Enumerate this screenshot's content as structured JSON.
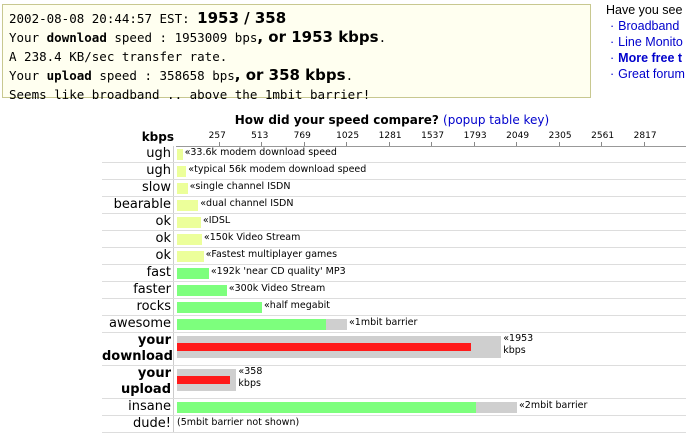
{
  "results": {
    "line1_prefix": "2002-08-08 20:44:57 EST: ",
    "line1_big": "1953 / 358",
    "line2_a": "Your ",
    "line2_kw": "download",
    "line2_b": " speed : 1953009 bps",
    "line2_big": ", or 1953 kbps",
    "line2_c": ".",
    "line3": "A 238.4 KB/sec transfer rate.",
    "line4_a": "Your ",
    "line4_kw": "upload",
    "line4_b": " speed : 358658 bps",
    "line4_big": ", or 358 kbps",
    "line4_c": ".",
    "line5": "Seems like broadband .. above the 1mbit barrier!"
  },
  "side": {
    "title": "Have you see",
    "items": [
      {
        "label": "Broadband",
        "bold": false
      },
      {
        "label": "Line Monito",
        "bold": false
      },
      {
        "label": "More free t",
        "bold": true
      },
      {
        "label": "Great forum",
        "bold": false
      }
    ]
  },
  "heading": {
    "text": "How did your speed compare? ",
    "link": "(popup table key)"
  },
  "scale": {
    "unit_label": "kbps",
    "ticks": [
      "257",
      "513",
      "769",
      "1025",
      "1281",
      "1537",
      "1793",
      "2049",
      "2305",
      "2561",
      "2817"
    ]
  },
  "chart_data": {
    "type": "bar",
    "unit": "kbps",
    "xlim": [
      0,
      3072
    ],
    "rows": [
      {
        "label": "ugh",
        "value": 33.6,
        "extent": 33.6,
        "note": "«33.6k modem download speed",
        "color": "yellow"
      },
      {
        "label": "ugh",
        "value": 56,
        "extent": 56,
        "note": "«typical 56k modem download speed",
        "color": "yellow"
      },
      {
        "label": "slow",
        "value": 64,
        "extent": 64,
        "note": "«single channel ISDN",
        "color": "yellow"
      },
      {
        "label": "bearable",
        "value": 128,
        "extent": 128,
        "note": "«dual channel ISDN",
        "color": "yellow"
      },
      {
        "label": "ok",
        "value": 144,
        "extent": 144,
        "note": "«IDSL",
        "color": "yellow"
      },
      {
        "label": "ok",
        "value": 150,
        "extent": 150,
        "note": "«150k Video Stream",
        "color": "yellow"
      },
      {
        "label": "ok",
        "value": 160,
        "extent": 160,
        "note": "«Fastest multiplayer games",
        "color": "yellow"
      },
      {
        "label": "fast",
        "value": 192,
        "extent": 192,
        "note": "«192k 'near CD quality' MP3",
        "color": "green"
      },
      {
        "label": "faster",
        "value": 300,
        "extent": 300,
        "note": "«300k Video Stream",
        "color": "green"
      },
      {
        "label": "rocks",
        "value": 512,
        "extent": 512,
        "note": "«half megabit",
        "color": "green"
      },
      {
        "label": "awesome",
        "value": 900,
        "extent": 1024,
        "note": "«1mbit barrier",
        "color": "green"
      },
      {
        "label": "your download",
        "value": 1770,
        "extent": 1953,
        "note": "«1953 kbps",
        "color": "red",
        "bold": true
      },
      {
        "label": "your upload",
        "value": 320,
        "extent": 358,
        "note": "«358 kbps",
        "color": "red",
        "bold": true
      },
      {
        "label": "insane",
        "value": 1800,
        "extent": 2048,
        "note": "«2mbit barrier",
        "color": "green"
      },
      {
        "label": "dude!",
        "value": 0,
        "extent": 0,
        "note": "(5mbit barrier not shown)",
        "color": "none"
      }
    ]
  }
}
